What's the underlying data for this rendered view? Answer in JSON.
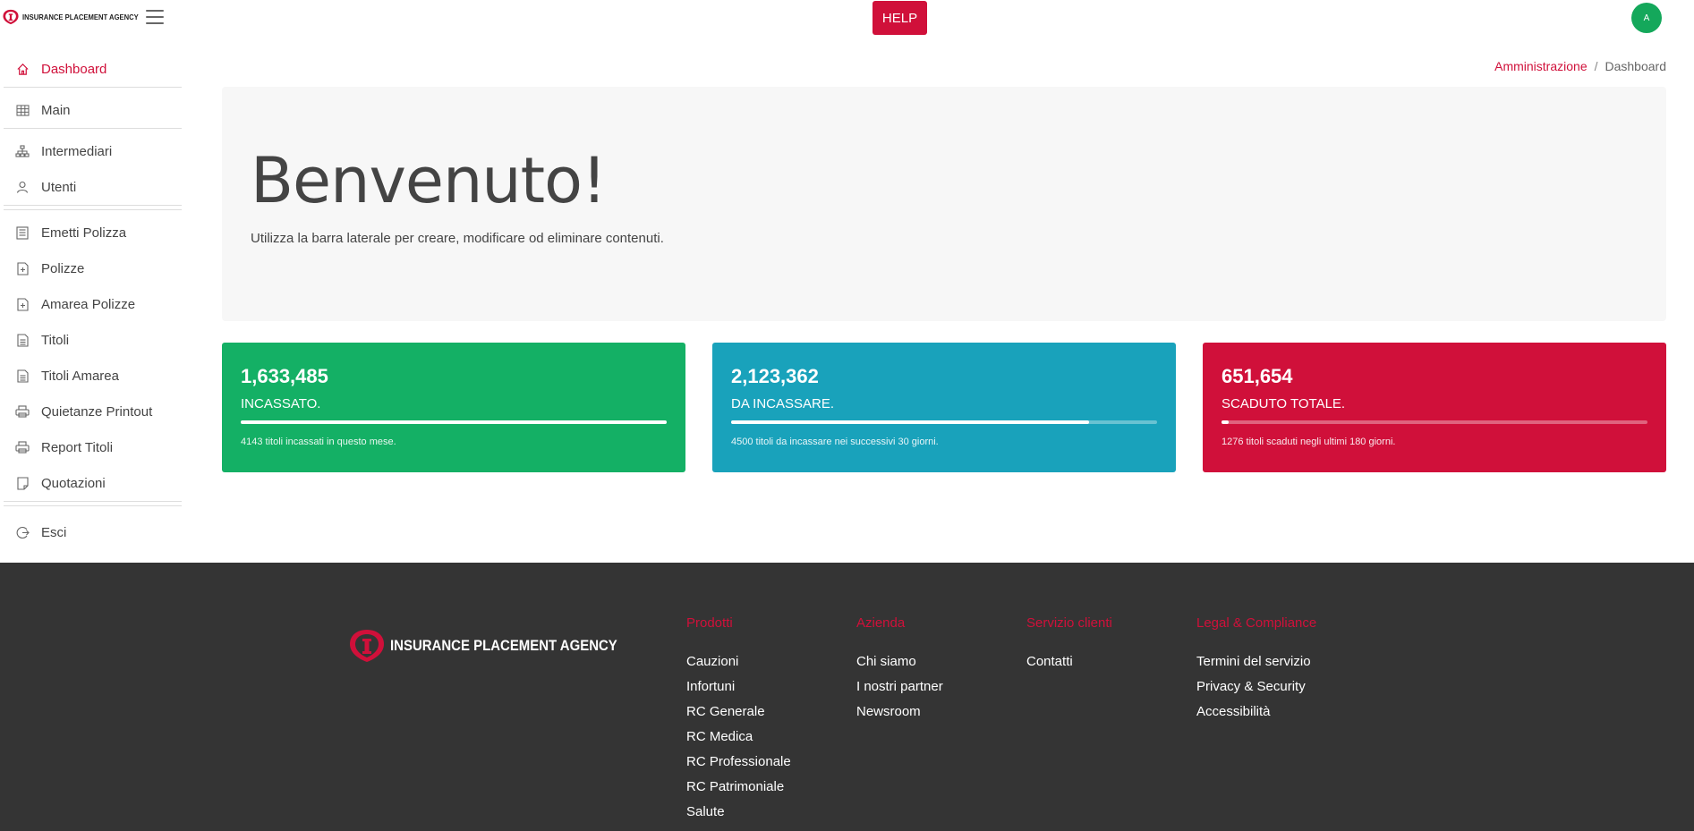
{
  "brand": {
    "name": "INSURANCE PLACEMENT AGENCY",
    "accent": "#d0103a"
  },
  "topbar": {
    "help_label": "HELP",
    "avatar_initial": "A"
  },
  "sidebar": {
    "items": [
      {
        "label": "Dashboard",
        "icon": "home-icon",
        "active": true
      },
      {
        "label": "Main",
        "icon": "table-icon"
      },
      {
        "label": "Intermediari",
        "icon": "sitemap-icon"
      },
      {
        "label": "Utenti",
        "icon": "user-icon"
      },
      {
        "label": "Emetti Polizza",
        "icon": "form-icon"
      },
      {
        "label": "Polizze",
        "icon": "file-plus-icon"
      },
      {
        "label": "Amarea Polizze",
        "icon": "file-plus-icon"
      },
      {
        "label": "Titoli",
        "icon": "document-icon"
      },
      {
        "label": "Titoli Amarea",
        "icon": "document-icon"
      },
      {
        "label": "Quietanze Printout",
        "icon": "printer-icon"
      },
      {
        "label": "Report Titoli",
        "icon": "printer-icon"
      },
      {
        "label": "Quotazioni",
        "icon": "note-icon"
      },
      {
        "label": "Esci",
        "icon": "logout-icon"
      }
    ]
  },
  "breadcrumb": {
    "parent": "Amministrazione",
    "separator": "/",
    "current": "Dashboard"
  },
  "hero": {
    "title": "Benvenuto!",
    "subtitle": "Utilizza la barra laterale per creare, modificare od eliminare contenuti."
  },
  "stats": [
    {
      "value": "1,633,485",
      "label": "INCASSATO.",
      "progress": 1.0,
      "description": "4143 titoli incassati in questo mese.",
      "color": "#14b065"
    },
    {
      "value": "2,123,362",
      "label": "DA INCASSARE.",
      "progress": 0.84,
      "description": "4500 titoli da incassare nei successivi 30 giorni.",
      "color": "#19a2bb"
    },
    {
      "value": "651,654",
      "label": "SCADUTO TOTALE.",
      "progress": 0.016,
      "description": "1276 titoli scaduti negli ultimi 180 giorni.",
      "color": "#d0103a"
    }
  ],
  "footer": {
    "columns": [
      {
        "title": "Prodotti",
        "links": [
          "Cauzioni",
          "Infortuni",
          "RC Generale",
          "RC Medica",
          "RC Professionale",
          "RC Patrimoniale",
          "Salute"
        ]
      },
      {
        "title": "Azienda",
        "links": [
          "Chi siamo",
          "I nostri partner",
          "Newsroom"
        ]
      },
      {
        "title": "Servizio clienti",
        "links": [
          "Contatti"
        ]
      },
      {
        "title": "Legal & Compliance",
        "links": [
          "Termini del servizio",
          "Privacy & Security",
          "Accessibilità"
        ]
      }
    ]
  }
}
